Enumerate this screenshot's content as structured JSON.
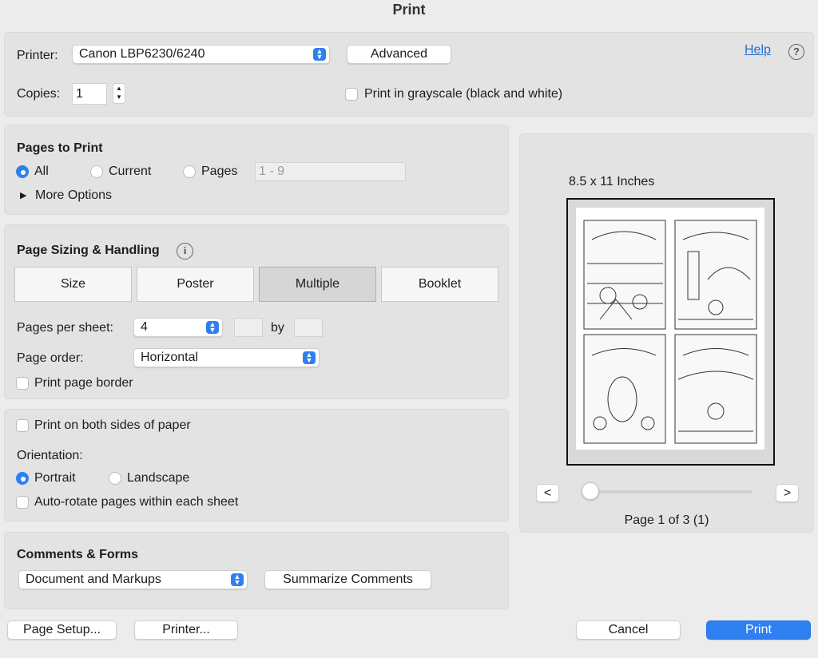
{
  "window": {
    "title": "Print"
  },
  "printer": {
    "label": "Printer:",
    "selected": "Canon LBP6230/6240",
    "advanced": "Advanced",
    "help": "Help"
  },
  "copies": {
    "label": "Copies:",
    "value": "1"
  },
  "grayscale": {
    "label": "Print in grayscale (black and white)"
  },
  "pages": {
    "heading": "Pages to Print",
    "all": "All",
    "current": "Current",
    "pages": "Pages",
    "range_placeholder": "1 - 9",
    "more_options": "More Options"
  },
  "sizing": {
    "heading": "Page Sizing & Handling",
    "tabs": [
      "Size",
      "Poster",
      "Multiple",
      "Booklet"
    ],
    "per_sheet_label": "Pages per sheet:",
    "per_sheet_value": "4",
    "by": "by",
    "order_label": "Page order:",
    "order_value": "Horizontal",
    "border_label": "Print page border"
  },
  "layout": {
    "both_sides": "Print on both sides of paper",
    "orientation_label": "Orientation:",
    "portrait": "Portrait",
    "landscape": "Landscape",
    "autorotate": "Auto-rotate pages within each sheet"
  },
  "comments": {
    "heading": "Comments & Forms",
    "selected": "Document and Markups",
    "summarize": "Summarize Comments"
  },
  "preview": {
    "size_label": "8.5 x 11 Inches",
    "prev": "<",
    "next": ">",
    "page_indicator": "Page 1 of 3 (1)",
    "slider_fraction": 0
  },
  "footer": {
    "page_setup": "Page Setup...",
    "printer": "Printer...",
    "cancel": "Cancel",
    "print": "Print"
  },
  "colors": {
    "accent": "#2f7ff0"
  }
}
